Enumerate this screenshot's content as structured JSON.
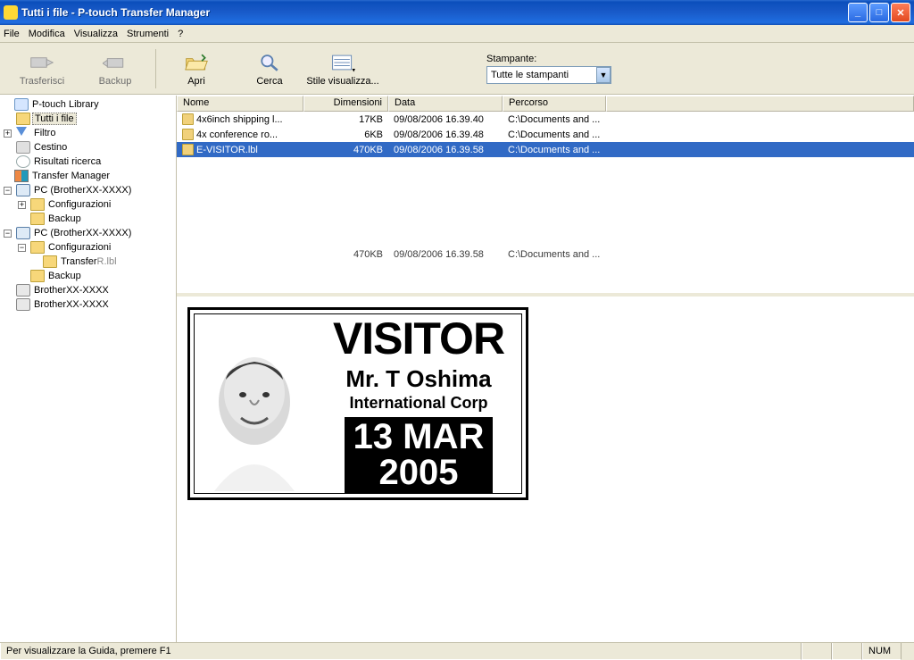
{
  "title": "Tutti i file - P-touch Transfer Manager",
  "menu": {
    "file": "File",
    "modifica": "Modifica",
    "visualizza": "Visualizza",
    "strumenti": "Strumenti",
    "help": "?"
  },
  "toolbar": {
    "trasferisci": "Trasferisci",
    "backup": "Backup",
    "apri": "Apri",
    "cerca": "Cerca",
    "stile": "Stile visualizza..."
  },
  "printer": {
    "label": "Stampante:",
    "selected": "Tutte le stampanti"
  },
  "tree": {
    "library": "P-touch Library",
    "all_files": "Tutti i file",
    "filter": "Filtro",
    "bin": "Cestino",
    "search": "Risultati ricerca",
    "tm": "Transfer Manager",
    "pc1": "PC (BrotherXX-XXXX)",
    "pc1_conf": "Configurazioni",
    "pc1_backup": "Backup",
    "pc2": "PC (BrotherXX-XXXX)",
    "pc2_conf": "Configurazioni",
    "pc2_transfer": "Transfer",
    "pc2_transfer_suffix": "R.lbl",
    "pc2_backup": "Backup",
    "printer1": "BrotherXX-XXXX",
    "printer2": "BrotherXX-XXXX"
  },
  "columns": {
    "nome": "Nome",
    "dim": "Dimensioni",
    "data": "Data",
    "percorso": "Percorso"
  },
  "files": [
    {
      "name": "4x6inch shipping l...",
      "size": "17KB",
      "date": "09/08/2006 16.39.40",
      "path": "C:\\Documents and ..."
    },
    {
      "name": "4x conference ro...",
      "size": "6KB",
      "date": "09/08/2006 16.39.48",
      "path": "C:\\Documents and ..."
    },
    {
      "name": "E-VISITOR.lbl",
      "size": "470KB",
      "date": "09/08/2006 16.39.58",
      "path": "C:\\Documents and ..."
    }
  ],
  "summary": {
    "size": "470KB",
    "date": "09/08/2006 16.39.58",
    "path": "C:\\Documents and ..."
  },
  "preview": {
    "title": "VISITOR",
    "name": "Mr. T Oshima",
    "org": "International Corp",
    "date1": "13 MAR",
    "date2": "2005"
  },
  "status": {
    "hint": "Per visualizzare la Guida, premere F1",
    "num": "NUM"
  }
}
